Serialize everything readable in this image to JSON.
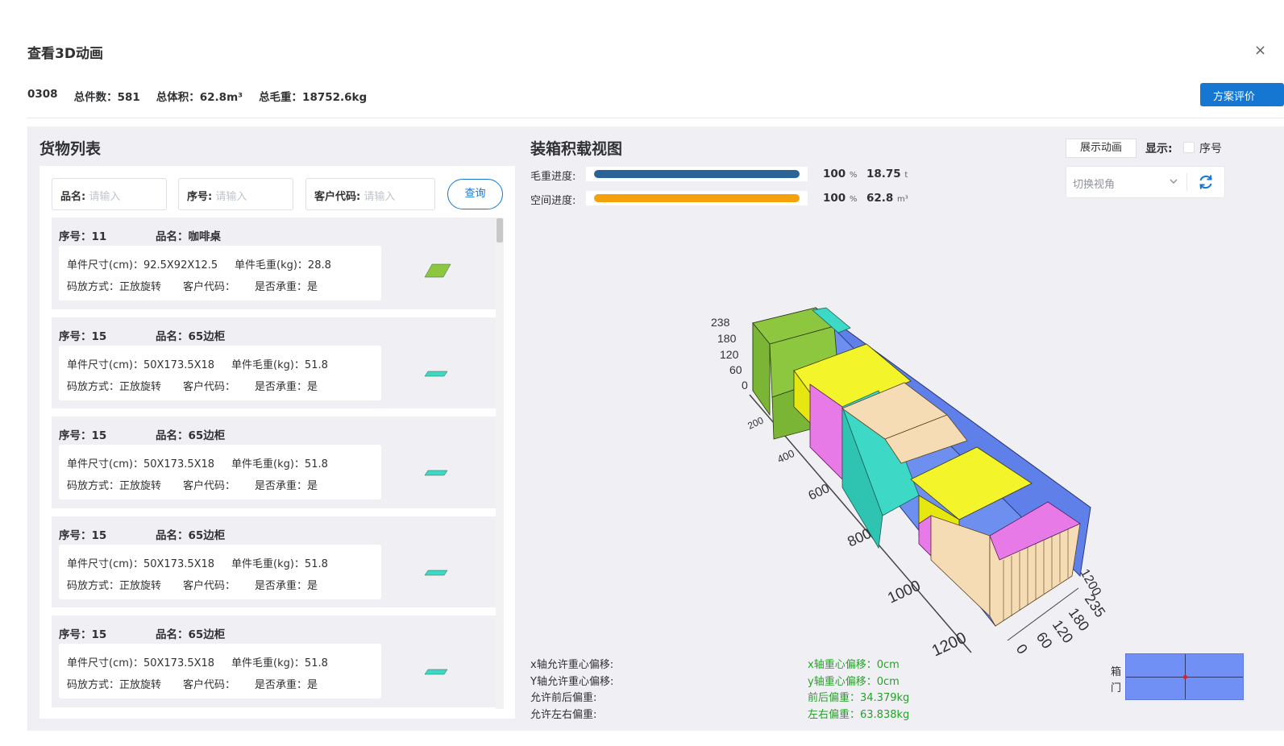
{
  "dialog": {
    "title": "查看3D动画",
    "close": "×"
  },
  "summary": {
    "code": "0308",
    "total_count": "总件数：581",
    "total_volume": "总体积：62.8m³",
    "total_weight": "总毛重：18752.6kg"
  },
  "eval_button": "方案评价",
  "cargo_list": {
    "title": "货物列表",
    "search": {
      "name_label": "品名:",
      "name_placeholder": "请输入",
      "seq_label": "序号:",
      "seq_placeholder": "请输入",
      "cust_label": "客户代码:",
      "cust_placeholder": "请输入",
      "query_button": "查询"
    },
    "items": [
      {
        "seq": "序号：11",
        "name": "品名：咖啡桌",
        "size": "单件尺寸(cm)：92.5X92X12.5",
        "weight": "单件毛重(kg)：28.8",
        "mode": "码放方式：正放旋转",
        "cust": "客户代码：",
        "bearing": "是否承重：是",
        "color": "#8dc63f"
      },
      {
        "seq": "序号：15",
        "name": "品名：65边柜",
        "size": "单件尺寸(cm)：50X173.5X18",
        "weight": "单件毛重(kg)：51.8",
        "mode": "码放方式：正放旋转",
        "cust": "客户代码：",
        "bearing": "是否承重：是",
        "color": "#3dd9c6"
      },
      {
        "seq": "序号：15",
        "name": "品名：65边柜",
        "size": "单件尺寸(cm)：50X173.5X18",
        "weight": "单件毛重(kg)：51.8",
        "mode": "码放方式：正放旋转",
        "cust": "客户代码：",
        "bearing": "是否承重：是",
        "color": "#3dd9c6"
      },
      {
        "seq": "序号：15",
        "name": "品名：65边柜",
        "size": "单件尺寸(cm)：50X173.5X18",
        "weight": "单件毛重(kg)：51.8",
        "mode": "码放方式：正放旋转",
        "cust": "客户代码：",
        "bearing": "是否承重：是",
        "color": "#3dd9c6"
      },
      {
        "seq": "序号：15",
        "name": "品名：65边柜",
        "size": "单件尺寸(cm)：50X173.5X18",
        "weight": "单件毛重(kg)：51.8",
        "mode": "码放方式：正放旋转",
        "cust": "客户代码：",
        "bearing": "是否承重：是",
        "color": "#3dd9c6"
      }
    ]
  },
  "load_view": {
    "title": "装箱积载视图",
    "weight_progress": {
      "label": "毛重进度:",
      "percent": 100,
      "percent_text": "100",
      "unit_pct": "%",
      "value": "18.75",
      "unit": "t",
      "color": "#2a6496"
    },
    "space_progress": {
      "label": "空间进度:",
      "percent": 100,
      "percent_text": "100",
      "unit_pct": "%",
      "value": "62.8",
      "unit": "m³",
      "color": "#f5a10a"
    },
    "show_animation_button": "展示动画",
    "display_label": "显示:",
    "seq_checkbox_label": "序号",
    "view_select_placeholder": "切换视角",
    "axes": {
      "height_ticks": [
        "238",
        "180",
        "120",
        "60",
        "0"
      ],
      "length_ticks": [
        "0",
        "200",
        "400",
        "600",
        "800",
        "1000",
        "1200"
      ],
      "end_length_tick": "1200",
      "width_ticks": [
        "235",
        "180",
        "120",
        "60",
        "0"
      ]
    },
    "stats": {
      "x_allow": "x轴允许重心偏移:",
      "y_allow": "Y轴允许重心偏移:",
      "fb_allow": "允许前后偏重:",
      "lr_allow": "允许左右偏重:",
      "x_offset": "x轴重心偏移：0cm",
      "y_offset": "y轴重心偏移：0cm",
      "fb_offset": "前后偏重：34.379kg",
      "lr_offset": "左右偏重：63.838kg"
    },
    "door_label_1": "箱",
    "door_label_2": "门"
  }
}
